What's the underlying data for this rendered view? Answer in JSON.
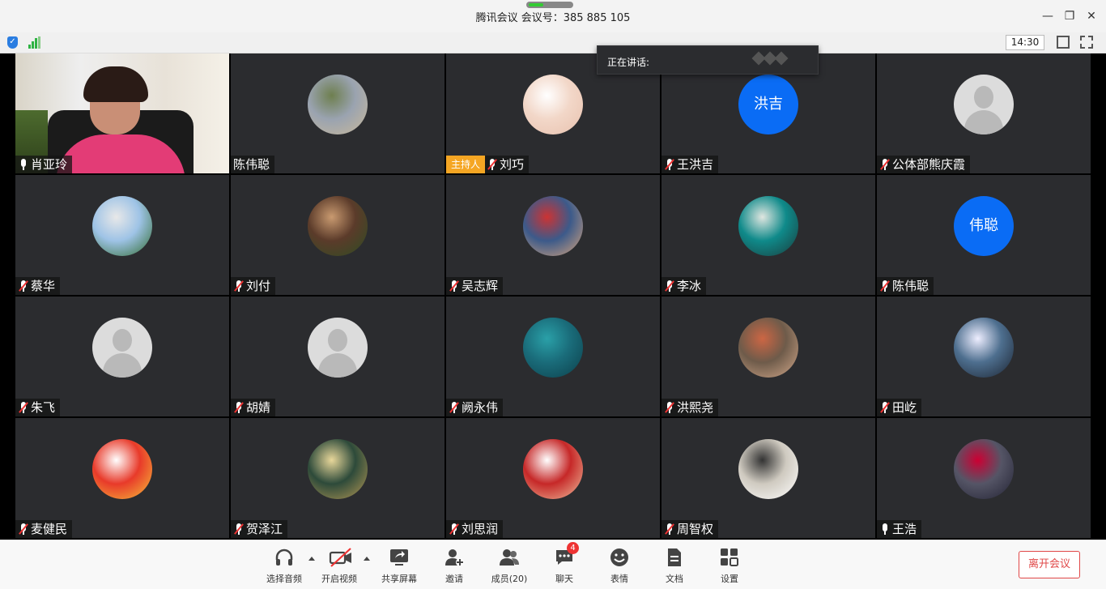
{
  "window": {
    "title": "腾讯会议 会议号：385 885 105",
    "clock": "14:30"
  },
  "speaking": {
    "label": "正在讲话:"
  },
  "participants": [
    {
      "name": "肖亚玲",
      "video": true,
      "muted": false,
      "avatar": "video"
    },
    {
      "name": "陈伟聪",
      "muted": null,
      "avatar": "photo-family",
      "colors": [
        "#9aa3b0",
        "#c9b99b",
        "#6e7f4f"
      ]
    },
    {
      "name": "刘巧",
      "host_badge": "主持人",
      "muted": true,
      "avatar": "photo-baby",
      "colors": [
        "#f2d7c8",
        "#e8c1ae",
        "#fff"
      ]
    },
    {
      "name": "王洪吉",
      "muted": true,
      "avatar": "text",
      "avatar_text": "洪吉"
    },
    {
      "name": "公体部熊庆霞",
      "muted": true,
      "avatar": "default"
    },
    {
      "name": "蔡华",
      "muted": true,
      "avatar": "photo-palm",
      "colors": [
        "#9ec3e6",
        "#2f6a2d",
        "#e8e8e8"
      ]
    },
    {
      "name": "刘付",
      "muted": true,
      "avatar": "photo-tree",
      "colors": [
        "#5b3b2a",
        "#2e4d23",
        "#c99a70"
      ]
    },
    {
      "name": "吴志辉",
      "muted": true,
      "avatar": "photo-kids",
      "colors": [
        "#3c5a8a",
        "#d8a57c",
        "#c33"
      ]
    },
    {
      "name": "李冰",
      "muted": true,
      "avatar": "photo-teal",
      "colors": [
        "#0f8a8a",
        "#1b3a3a",
        "#e0e6e0"
      ]
    },
    {
      "name": "陈伟聪",
      "muted": true,
      "avatar": "text",
      "avatar_text": "伟聪"
    },
    {
      "name": "朱飞",
      "muted": true,
      "avatar": "default"
    },
    {
      "name": "胡婧",
      "muted": true,
      "avatar": "default"
    },
    {
      "name": "阙永伟",
      "muted": true,
      "avatar": "photo-cat",
      "colors": [
        "#1a6c7a",
        "#0c3f4a",
        "#2aa0a8"
      ]
    },
    {
      "name": "洪熙尧",
      "muted": true,
      "avatar": "photo-man",
      "colors": [
        "#6e5b4a",
        "#d3a98b",
        "#c64"
      ]
    },
    {
      "name": "田屹",
      "muted": true,
      "avatar": "photo-anime",
      "colors": [
        "#4e6f8f",
        "#1b2330",
        "#eef"
      ]
    },
    {
      "name": "麦健民",
      "muted": true,
      "avatar": "photo-sport",
      "colors": [
        "#e83a2a",
        "#f6c23a",
        "#fff"
      ]
    },
    {
      "name": "贺泽江",
      "muted": true,
      "avatar": "photo-lake",
      "colors": [
        "#2d4a3a",
        "#b79a55",
        "#e8d79a"
      ]
    },
    {
      "name": "刘思润",
      "muted": true,
      "avatar": "photo-soccer",
      "colors": [
        "#c62828",
        "#f0c2a0",
        "#fff"
      ]
    },
    {
      "name": "周智权",
      "muted": true,
      "avatar": "photo-man2",
      "colors": [
        "#cfcac0",
        "#fff",
        "#333"
      ]
    },
    {
      "name": "王浩",
      "muted": false,
      "avatar": "photo-car",
      "colors": [
        "#556",
        "#223",
        "#c03"
      ]
    }
  ],
  "controls": [
    {
      "label": "选择音频",
      "icon": "headphones-icon",
      "caret": true
    },
    {
      "label": "开启视频",
      "icon": "video-off-icon",
      "caret": true
    },
    {
      "label": "共享屏幕",
      "icon": "share-screen-icon"
    },
    {
      "label": "邀请",
      "icon": "invite-icon"
    },
    {
      "label": "成员(20)",
      "icon": "members-icon"
    },
    {
      "label": "聊天",
      "icon": "chat-icon",
      "badge": "4"
    },
    {
      "label": "表情",
      "icon": "emoji-icon"
    },
    {
      "label": "文档",
      "icon": "document-icon"
    },
    {
      "label": "设置",
      "icon": "settings-icon"
    }
  ],
  "leave_button": "离开会议"
}
